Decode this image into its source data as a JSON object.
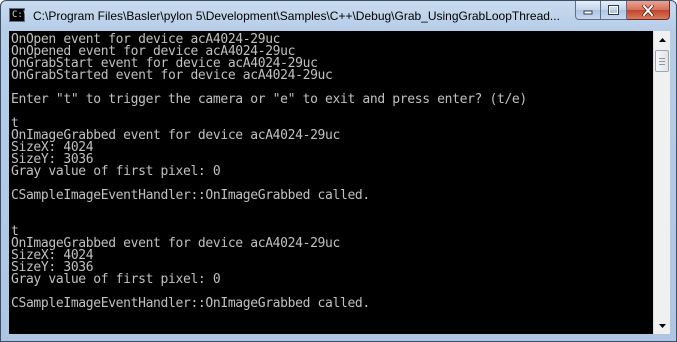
{
  "window": {
    "title": "C:\\Program Files\\Basler\\pylon 5\\Development\\Samples\\C++\\Debug\\Grab_UsingGrabLoopThread...",
    "icon": "console-window-icon",
    "icon_glyph": "C:\\",
    "buttons": {
      "minimize": "minimize-icon",
      "maximize": "maximize-icon",
      "close": "close-icon"
    }
  },
  "console": {
    "background": "#000000",
    "foreground": "#c0c0c0",
    "lines": [
      "OnOpen event for device acA4024-29uc",
      "OnOpened event for device acA4024-29uc",
      "OnGrabStart event for device acA4024-29uc",
      "OnGrabStarted event for device acA4024-29uc",
      "",
      "Enter \"t\" to trigger the camera or \"e\" to exit and press enter? (t/e)",
      "",
      "t",
      "OnImageGrabbed event for device acA4024-29uc",
      "SizeX: 4024",
      "SizeY: 3036",
      "Gray value of first pixel: 0",
      "",
      "CSampleImageEventHandler::OnImageGrabbed called.",
      "",
      "",
      "t",
      "OnImageGrabbed event for device acA4024-29uc",
      "SizeX: 4024",
      "SizeY: 3036",
      "Gray value of first pixel: 0",
      "",
      "CSampleImageEventHandler::OnImageGrabbed called.",
      ""
    ]
  },
  "scrollbar": {
    "up_icon": "scroll-up-arrow-icon",
    "down_icon": "scroll-down-arrow-icon"
  }
}
